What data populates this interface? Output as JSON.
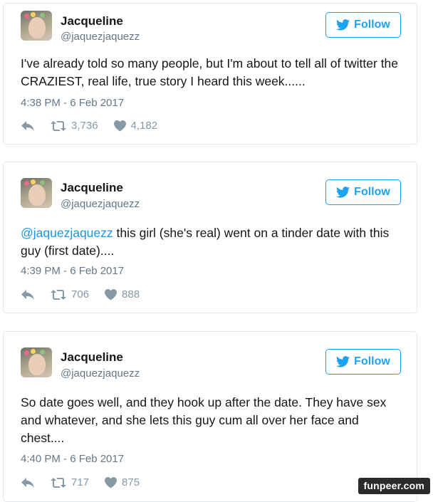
{
  "tweets": [
    {
      "name": "Jacqueline",
      "handle": "@jaquezjaquezz",
      "follow_label": "Follow",
      "mention": "",
      "text": "I've already told so many people, but I'm about to tell all of twitter the CRAZIEST, real life, true story I heard this week......",
      "time": "4:38 PM - 6 Feb 2017",
      "retweets": "3,736",
      "likes": "4,182"
    },
    {
      "name": "Jacqueline",
      "handle": "@jaquezjaquezz",
      "follow_label": "Follow",
      "mention": "@jaquezjaquezz",
      "text": " this girl (she's real) went on a tinder date with this guy (first date)....",
      "time": "4:39 PM - 6 Feb 2017",
      "retweets": "706",
      "likes": "888"
    },
    {
      "name": "Jacqueline",
      "handle": "@jaquezjaquezz",
      "follow_label": "Follow",
      "mention": "",
      "text": "So date goes well, and they hook up after the date. They have sex and whatever, and she lets this guy cum all over her face and chest....",
      "time": "4:40 PM - 6 Feb 2017",
      "retweets": "717",
      "likes": "875"
    }
  ],
  "watermark": "funpeer.com",
  "colors": {
    "accent": "#1da1f2",
    "mention": "#1b95e0",
    "muted": "#657786",
    "icon": "#8899a6"
  },
  "icons": [
    "twitter-bird-icon",
    "reply-icon",
    "retweet-icon",
    "heart-icon"
  ]
}
